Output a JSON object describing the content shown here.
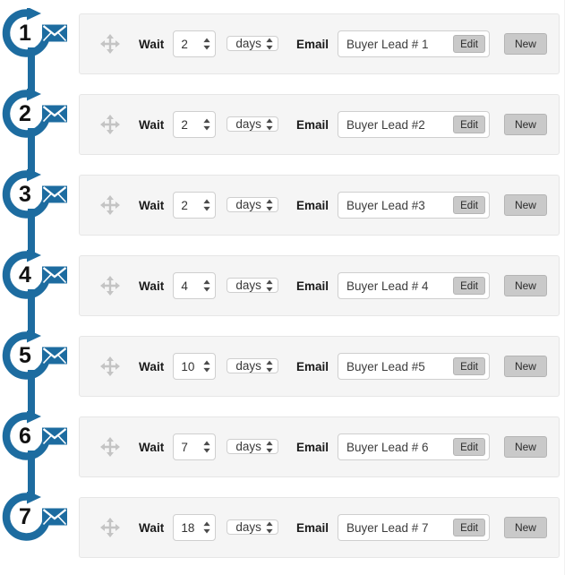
{
  "labels": {
    "wait": "Wait",
    "email": "Email",
    "edit": "Edit",
    "new": "New"
  },
  "icons": {
    "move_handle": "move-arrows-icon",
    "step_badge": "circular-arrow-envelope-icon",
    "spinner": "spinner-up-down-icon"
  },
  "colors": {
    "accent": "#1d6ca0",
    "row_background": "#f5f5f5",
    "row_border": "#e6e6e6",
    "button_gray": "#c9c9c9",
    "input_border": "#cfcfcf",
    "page_background": "#ffffff"
  },
  "steps": [
    {
      "number": "1",
      "wait_value": "2",
      "unit": "days",
      "email_name": "Buyer Lead # 1"
    },
    {
      "number": "2",
      "wait_value": "2",
      "unit": "days",
      "email_name": "Buyer Lead #2"
    },
    {
      "number": "3",
      "wait_value": "2",
      "unit": "days",
      "email_name": "Buyer Lead #3"
    },
    {
      "number": "4",
      "wait_value": "4",
      "unit": "days",
      "email_name": "Buyer Lead # 4"
    },
    {
      "number": "5",
      "wait_value": "10",
      "unit": "days",
      "email_name": "Buyer Lead #5"
    },
    {
      "number": "6",
      "wait_value": "7",
      "unit": "days",
      "email_name": "Buyer Lead # 6"
    },
    {
      "number": "7",
      "wait_value": "18",
      "unit": "days",
      "email_name": "Buyer Lead # 7"
    }
  ]
}
